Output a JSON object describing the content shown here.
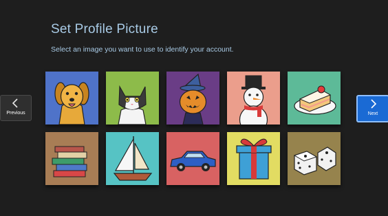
{
  "header": {
    "title": "Set Profile Picture",
    "subtitle": "Select an image you want to use to identify your account."
  },
  "nav": {
    "previous_label": "Previous",
    "next_label": "Next"
  },
  "pictures": [
    {
      "name": "dog",
      "bg": "#4f73c9"
    },
    {
      "name": "cat",
      "bg": "#8dbb4a"
    },
    {
      "name": "pumpkin",
      "bg": "#6a3d86"
    },
    {
      "name": "snowman",
      "bg": "#eb9e8c"
    },
    {
      "name": "cake",
      "bg": "#5dba98"
    },
    {
      "name": "books",
      "bg": "#a87d55"
    },
    {
      "name": "sailboat",
      "bg": "#56c3c4"
    },
    {
      "name": "car",
      "bg": "#d86262"
    },
    {
      "name": "gift",
      "bg": "#e2dc62"
    },
    {
      "name": "dice",
      "bg": "#96834d"
    }
  ]
}
